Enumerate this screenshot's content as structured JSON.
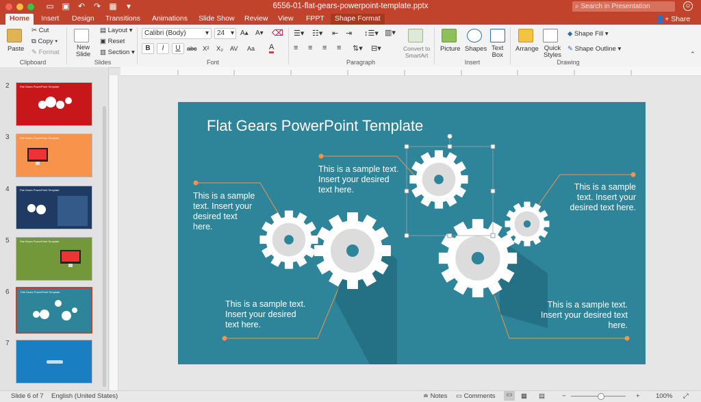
{
  "window": {
    "title": "6556-01-flat-gears-powerpoint-template.pptx",
    "search_placeholder": "Search in Presentation",
    "share_label": "Share"
  },
  "tabs": [
    "Home",
    "Insert",
    "Design",
    "Transitions",
    "Animations",
    "Slide Show",
    "Review",
    "View",
    "FPPT",
    "Shape Format"
  ],
  "ribbon": {
    "paste": "Paste",
    "cut": "Cut",
    "copy": "Copy",
    "format": "Format",
    "clipboard": "Clipboard",
    "new_slide_1": "New",
    "new_slide_2": "Slide",
    "layout": "Layout",
    "reset": "Reset",
    "section": "Section",
    "slides": "Slides",
    "font_name": "Calibri (Body)",
    "font_size": "24",
    "font": "Font",
    "paragraph": "Paragraph",
    "convert_1": "Convert to",
    "convert_2": "SmartArt",
    "picture": "Picture",
    "shapes": "Shapes",
    "textbox_1": "Text",
    "textbox_2": "Box",
    "insert": "Insert",
    "arrange": "Arrange",
    "quick_1": "Quick",
    "quick_2": "Styles",
    "shape_fill": "Shape Fill",
    "shape_outline": "Shape Outline",
    "drawing": "Drawing",
    "font_buttons": [
      "B",
      "I",
      "U",
      "abc",
      "X²",
      "X₂",
      "AV",
      "Aa",
      "A"
    ]
  },
  "thumbnails": [
    {
      "num": "2",
      "title": "Flat Gears PowerPoint Template",
      "bg": "#c8171b"
    },
    {
      "num": "3",
      "title": "Flat Gears PowerPoint Template",
      "bg": "#f7934a"
    },
    {
      "num": "4",
      "title": "Flat Gears PowerPoint Template",
      "bg": "#1f3b63"
    },
    {
      "num": "5",
      "title": "Flat Gears PowerPoint Template",
      "bg": "#73983a"
    },
    {
      "num": "6",
      "title": "Flat Gears PowerPoint Template",
      "bg": "#2e8499"
    },
    {
      "num": "7",
      "title": "",
      "bg": "#1a7fc2"
    }
  ],
  "slide": {
    "title": "Flat Gears PowerPoint Template",
    "text_top_center": [
      "This is a sample text.",
      "Insert your desired",
      "text here."
    ],
    "text_left": [
      "This is a sample",
      "text. Insert your",
      "desired text",
      "here."
    ],
    "text_right_top": [
      "This is a sample",
      "text. Insert your",
      "desired text here."
    ],
    "text_bottom_left": [
      "This is a sample text.",
      "Insert your desired",
      "text here."
    ],
    "text_bottom_right": [
      "This is a sample text.",
      "Insert your desired text",
      "here."
    ]
  },
  "colors": {
    "accent": "#c1432b",
    "slide_bg": "#2e8499",
    "connector": "#f7934a",
    "gear": "#ffffff",
    "gear_hub": "#dcdcdc"
  },
  "status": {
    "slide_of": "Slide 6 of 7",
    "language": "English (United States)",
    "notes": "Notes",
    "comments": "Comments",
    "zoom": "100%",
    "zoom_level": 0.55
  }
}
